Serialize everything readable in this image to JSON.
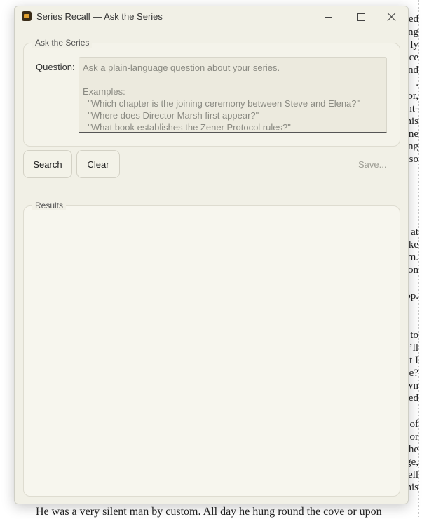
{
  "window": {
    "title": "Series Recall — Ask the Series"
  },
  "ask_group": {
    "legend": "Ask the Series",
    "question_label": "Question:",
    "placeholder": "Ask a plain-language question about your series.\n\nExamples:\n  \"Which chapter is the joining ceremony between Steve and Elena?\"\n  \"Where does Director Marsh first appear?\"\n  \"What book establishes the Zener Protocol rules?\""
  },
  "buttons": {
    "search": "Search",
    "clear": "Clear",
    "save": "Save..."
  },
  "results_group": {
    "legend": "Results"
  },
  "background_doc": {
    "fragments": [
      "ed",
      "ng",
      "ly",
      "ce",
      "nd",
      ".",
      "or,",
      "nt-",
      "his",
      "ne",
      "ng",
      "so",
      "at",
      "ke",
      "m.",
      "on",
      "op.",
      "to",
      "t’ll",
      "t I",
      "e?",
      "wn",
      "ed",
      "of",
      "or",
      "he",
      "ge,",
      "ell",
      "his"
    ],
    "bottom_line": "He was a very silent man by custom. All day he hung round the cove or upon"
  }
}
